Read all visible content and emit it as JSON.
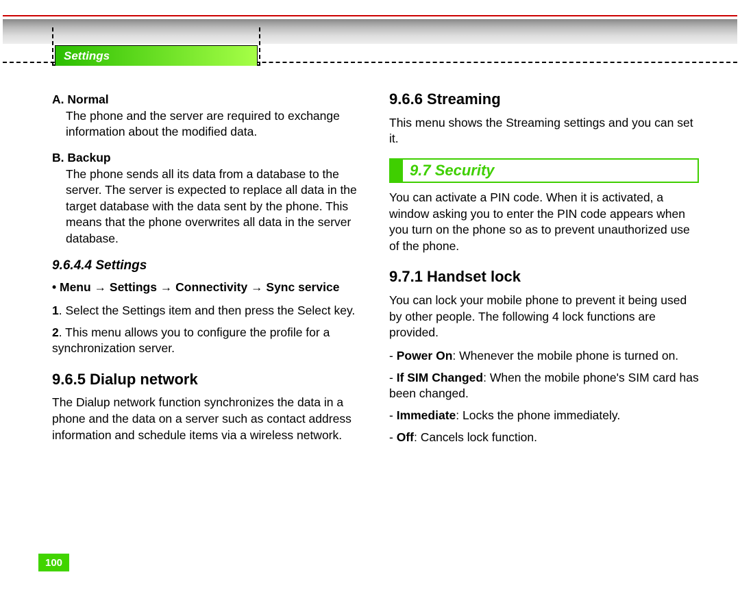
{
  "tab": {
    "label": "Settings"
  },
  "left": {
    "a": {
      "head": "A. Normal",
      "body": "The phone and the server are required to exchange information about the modified data."
    },
    "b": {
      "head": "B. Backup",
      "body": "The phone sends all its data from a database to the server. The server is expected to replace all data in the target database with the data sent by the phone. This means that the phone overwrites all data in the server database."
    },
    "s9644": {
      "title": "9.6.4.4 Settings",
      "path": "• Menu → Settings → Connectivity → Sync service",
      "step1n": "1",
      "step1": ". Select the Settings item and then press the Select key.",
      "step2n": "2",
      "step2": ". This menu allows you to configure the profile for a synchronization server."
    },
    "s965": {
      "title": "9.6.5 Dialup network",
      "body": "The Dialup network function synchronizes the data in a phone and the data on a server such as contact address information and schedule items via a wireless network."
    }
  },
  "right": {
    "s966": {
      "title": "9.6.6 Streaming",
      "body": "This menu shows the Streaming settings and you can set it."
    },
    "sec97": {
      "title": "9.7 Security",
      "body": "You can activate a PIN code. When it is activated, a window asking you to enter the PIN code appears when you turn on the phone so as to prevent unauthorized use of the phone."
    },
    "s971": {
      "title": "9.7.1 Handset lock",
      "intro": "You can lock your mobile phone to prevent it being used by other people. The following 4 lock functions are provided.",
      "opt1b": "Power On",
      "opt1t": ": Whenever the mobile phone is turned on.",
      "opt2b": "If SIM Changed",
      "opt2t": ": When the mobile phone's SIM card has been changed.",
      "opt3b": "Immediate",
      "opt3t": ": Locks the phone immediately.",
      "opt4b": "Off",
      "opt4t": ": Cancels lock function."
    }
  },
  "pageNumber": "100"
}
